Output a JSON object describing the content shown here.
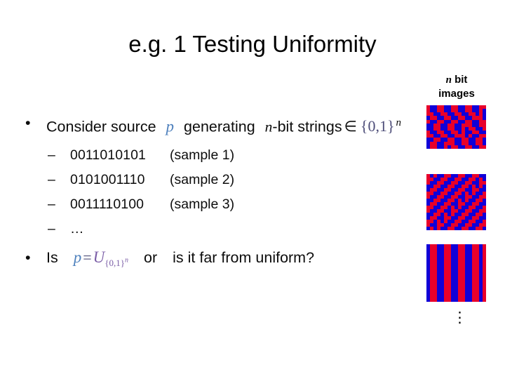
{
  "slide": {
    "title": "e.g. 1 Testing Uniformity",
    "bullets": {
      "b1": {
        "marker": "•",
        "text_before": "Consider source",
        "var_p": "p",
        "text_mid": "generating",
        "var_n": "n",
        "text_after": "-bit strings",
        "elem_symbol": "∈",
        "set": "{0,1}",
        "set_exponent": "n"
      },
      "samples": [
        {
          "marker": "–",
          "bits": "0011010101",
          "tag": "(sample 1)"
        },
        {
          "marker": "–",
          "bits": "0101001110",
          "tag": "(sample 2)"
        },
        {
          "marker": "–",
          "bits": "0011110100",
          "tag": "(sample 3)"
        },
        {
          "marker": "–",
          "bits": "…",
          "tag": ""
        }
      ],
      "b2": {
        "marker": "•",
        "text_is": "Is",
        "var_p": "p",
        "equals": "=",
        "var_u": "U",
        "subscript_set": "{0,1}",
        "subscript_exponent": "n",
        "text_or": "or",
        "text_question": "is it far from uniform?"
      }
    }
  },
  "right_panel": {
    "label_line1_var": "n",
    "label_line1_rest": " bit",
    "label_line2": "images",
    "vertical_ellipsis": "⋮",
    "colors": {
      "red": "#e8002a",
      "blue": "#1000d8",
      "accent_p": "#4f81bd",
      "accent_u": "#7b5ea7"
    },
    "images": [
      {
        "name": "n-bit-image-1",
        "cols": 17,
        "rows": 12,
        "pixels": "01100110011001100011001100110011010011001100110010110011001100110001011001100110011001100110011000110011001100110100110011001100101100110011001100010110011001100110011001100110001100110011001101001100110011001011001100110011000101100110011001100110011001100011"
      },
      {
        "name": "n-bit-image-2",
        "cols": 17,
        "rows": 16,
        "pixels": "01011001100110011001100110011001010110011001100110011001100110010101100110011001100110011001100101011001100110011001100110011001010110011001100110011001100110010101100110011001100110011001100101011001100110011001100110011001010110011001100110011001100110010101100110011001100110011001100101011001100110011001100110011001010110011001100110011001100110010101100110011001100110011001100101"
      },
      {
        "name": "n-bit-image-3",
        "cols": 17,
        "rows": 16,
        "pixels": "10011001100110010100110011001100101001100110011001010011001100110010100110011001100101001100110011001010011001100110010100110011001100101001100110011001010011001100110010100110011001100101001100110011001010011001100110010100110011001100101001100110011001010011001100110010100110011001100101001100110011001010011001100110010100110011001100101"
      }
    ]
  }
}
